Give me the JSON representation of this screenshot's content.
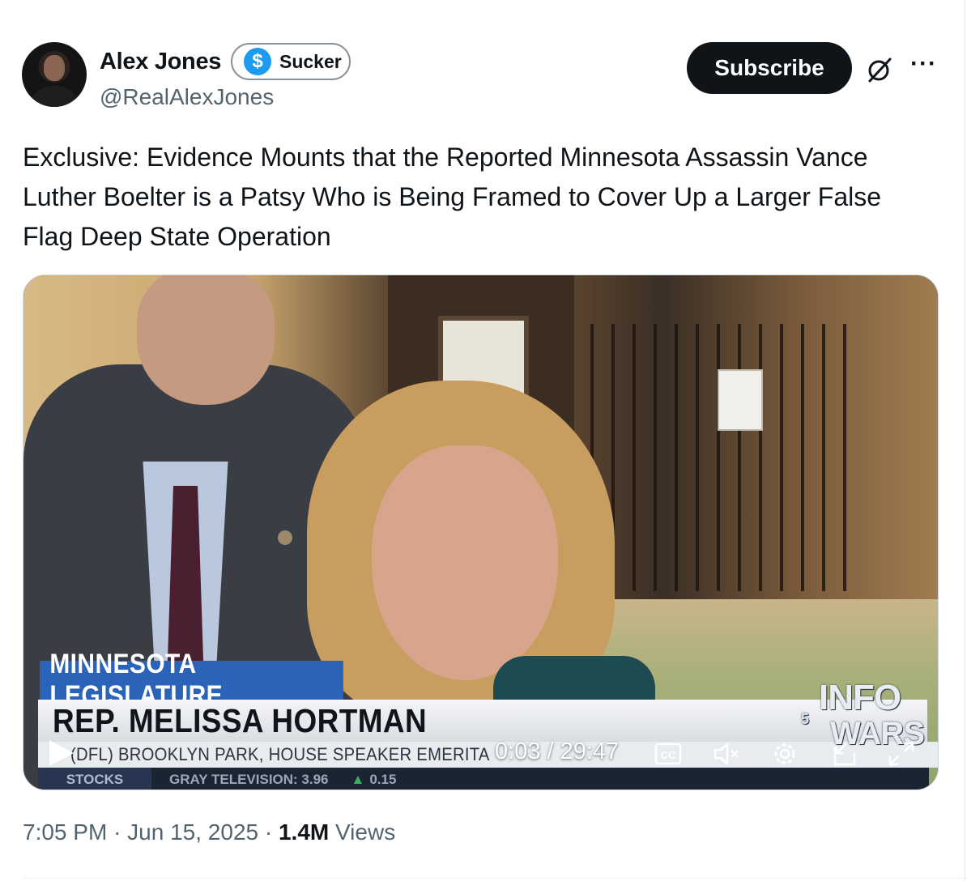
{
  "author": {
    "name": "Alex Jones",
    "handle": "@RealAlexJones",
    "badge_label": "Sucker",
    "badge_symbol": "$"
  },
  "actions": {
    "subscribe_label": "Subscribe",
    "grok_icon": "grok-icon",
    "more_label": "···"
  },
  "tweet": {
    "text": "Exclusive: Evidence Mounts that the Reported Minnesota Assassin Vance Luther Boelter is a Patsy Who is Being Framed to Cover Up a Larger False Flag Deep State Operation"
  },
  "video": {
    "lower_third_top": "MINNESOTA LEGISLATURE",
    "lower_third_main": "REP. MELISSA HORTMAN",
    "lower_third_sub": "(DFL) BROOKLYN PARK, HOUSE SPEAKER EMERITA",
    "ticker_label": "STOCKS",
    "ticker_quote": "GRAY TELEVISION: 3.96",
    "ticker_change": "0.15",
    "logo_line1": "INFO",
    "logo_line2": "WARS",
    "channel_number": "5",
    "time_display": "0:03 / 29:47",
    "progress": 0.0017,
    "controls": [
      "play-icon",
      "cc-icon",
      "mute-icon",
      "gear-icon",
      "pip-icon",
      "fullscreen-icon"
    ]
  },
  "meta": {
    "time": "7:05 PM",
    "separator": "·",
    "date": "Jun 15, 2025",
    "views_count": "1.4M",
    "views_label": "Views"
  },
  "colors": {
    "subscribe_bg": "#0f1419",
    "badge_coin": "#1d9bf0",
    "secondary_text": "#536471",
    "lower_third_blue": "#2a63b7"
  }
}
